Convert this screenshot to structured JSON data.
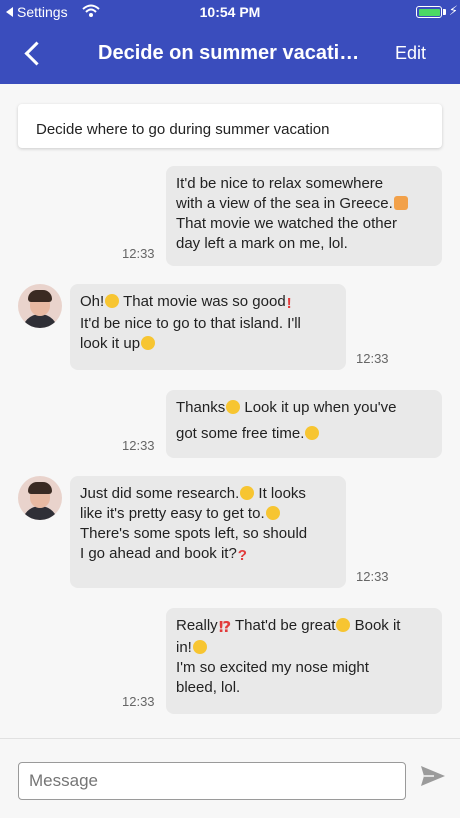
{
  "status_bar": {
    "back_app_label": "Settings",
    "time": "10:54 PM",
    "battery_color": "#4cd964"
  },
  "nav": {
    "title": "Decide on summer vacatio...",
    "edit_label": "Edit"
  },
  "topic": "Decide where to go during summer vacation",
  "messages": [
    {
      "side": "outgoing",
      "lines": [
        "It'd be nice to relax somewhere",
        "with a view of the sea in Greece.",
        "That movie we watched the other",
        "day left a mark on me, lol."
      ],
      "time": "12:33"
    },
    {
      "side": "incoming",
      "lines": [
        "Oh!",
        " That movie was so good",
        "It'd be nice to go to that island. I'll",
        "look it up"
      ],
      "time": "12:33"
    },
    {
      "side": "outgoing",
      "lines": [
        "Thanks",
        " Look it up when you've",
        "got some free time."
      ],
      "time": "12:33"
    },
    {
      "side": "incoming",
      "lines": [
        "Just did some research.",
        " It looks",
        "like it's pretty easy to get to.",
        "There's some spots left, so should",
        "I go ahead and book it?"
      ],
      "time": "12:33"
    },
    {
      "side": "outgoing",
      "lines": [
        "Really",
        " That'd be great",
        " Book it",
        "in!",
        " I'm so excited my nose might",
        "bleed, lol."
      ],
      "time": "12:33"
    }
  ],
  "composer": {
    "placeholder": "Message"
  },
  "colors": {
    "accent": "#3a4dbd",
    "bubble": "#e9e9e9",
    "background": "#f7f7f7"
  }
}
